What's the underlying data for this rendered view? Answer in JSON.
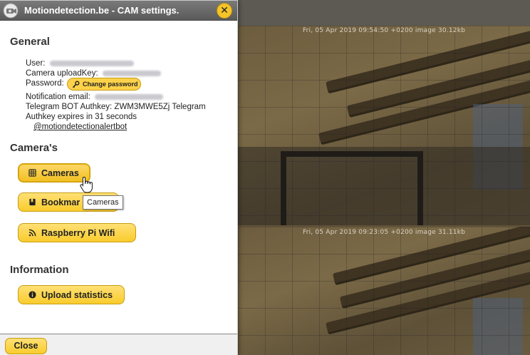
{
  "dialog": {
    "title": "Motiondetection.be - CAM settings.",
    "close_icon": "x"
  },
  "general": {
    "heading": "General",
    "user_label": "User:",
    "upload_key_label": "Camera uploadKey:",
    "password_label": "Password:",
    "change_password_label": "Change password",
    "notification_email_label": "Notification email:",
    "telegram_authkey_text": "Telegram BOT Authkey: ZWM3MWE5Zj Telegram",
    "authkey_expiry_text": "Authkey expires in 31 seconds",
    "telegram_bot_link": "@motiondetectionalertbot"
  },
  "cameras": {
    "heading": "Camera's",
    "cameras_button": "Cameras",
    "bookmarks_button": "Bookmar",
    "rpi_wifi_button": "Raspberry Pi Wifi"
  },
  "information": {
    "heading": "Information",
    "upload_stats_button": "Upload statistics"
  },
  "footer": {
    "close_button": "Close"
  },
  "tooltip": {
    "text": "Cameras"
  },
  "camera_feed": {
    "frame1_stamp": "Fri, 05 Apr 2019 09:54:50 +0200 image 30.12kb",
    "frame2_stamp": "Fri, 05 Apr 2019 09:23:05 +0200 image 31.11kb"
  },
  "colors": {
    "accent": "#f9cc2d",
    "titlebar": "#666666"
  }
}
